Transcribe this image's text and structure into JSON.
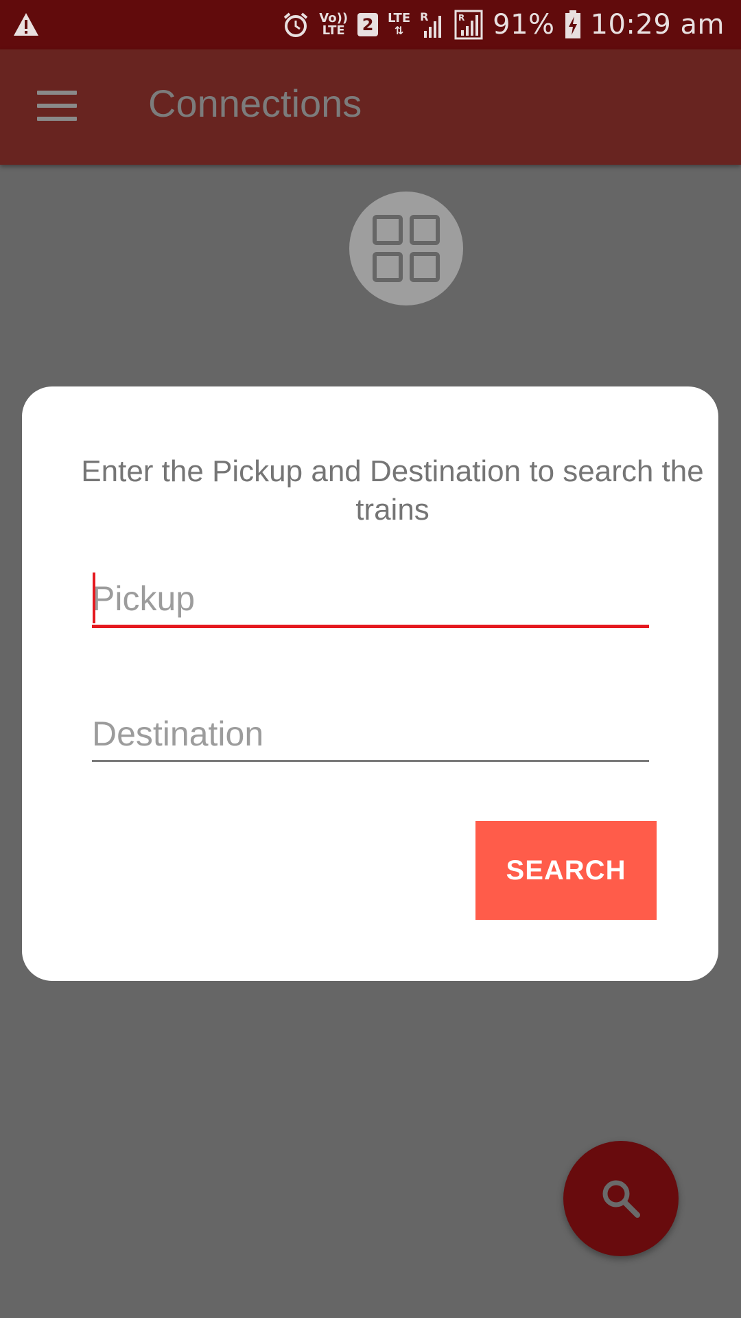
{
  "status_bar": {
    "battery": "91%",
    "time": "10:29 am",
    "sim_badge": "2",
    "volte_top": "Vo))",
    "volte_bottom": "LTE",
    "lte": "LTE",
    "roaming": "R",
    "icons": [
      "warning-icon",
      "alarm-icon",
      "volte-icon",
      "sim-2-icon",
      "lte-data-icon",
      "signal-icon",
      "signal-roaming-icon",
      "battery-charging-icon"
    ]
  },
  "app_bar": {
    "title": "Connections",
    "menu_icon": "hamburger-menu-icon"
  },
  "header_icon": "grid-view-icon",
  "dialog": {
    "message": "Enter the Pickup and Destination to search the trains",
    "pickup": {
      "placeholder": "Pickup",
      "value": ""
    },
    "destination": {
      "placeholder": "Destination",
      "value": ""
    },
    "search_label": "SEARCH"
  },
  "fab": {
    "icon": "search-icon"
  },
  "colors": {
    "status_bar": "#610b0c",
    "app_bar": "#682420",
    "scrim_background": "#666666",
    "accent_red": "#e5191f",
    "search_button": "#ff5c4a",
    "fab": "#680b0d"
  }
}
